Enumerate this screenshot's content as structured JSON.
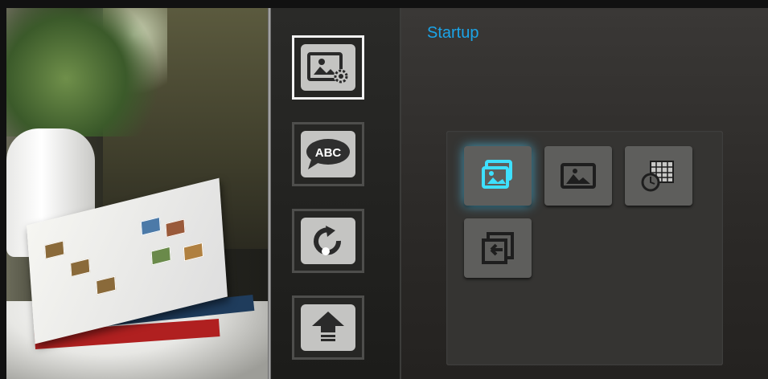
{
  "page": {
    "title": "Startup"
  },
  "menu": {
    "items": [
      {
        "name": "photo-settings",
        "icon": "photo-settings-icon",
        "selected": true
      },
      {
        "name": "language",
        "icon": "abc-speech-bubble-icon",
        "label": "ABC",
        "selected": false
      },
      {
        "name": "reset",
        "icon": "refresh-icon",
        "selected": false
      },
      {
        "name": "upgrade",
        "icon": "up-arrow-icon",
        "selected": false
      }
    ]
  },
  "startup_options": [
    {
      "name": "slideshow",
      "icon": "slideshow-icon",
      "selected": true
    },
    {
      "name": "single-photo",
      "icon": "photo-icon",
      "selected": false
    },
    {
      "name": "calendar-clock",
      "icon": "calendar-clock-icon",
      "selected": false
    },
    {
      "name": "last-mode",
      "icon": "return-icon",
      "selected": false
    }
  ],
  "colors": {
    "accent": "#1ba4e8",
    "selected_glow": "#3ee0ff",
    "tile": "#c4c4c2",
    "option_bg": "#5e5e5c"
  }
}
